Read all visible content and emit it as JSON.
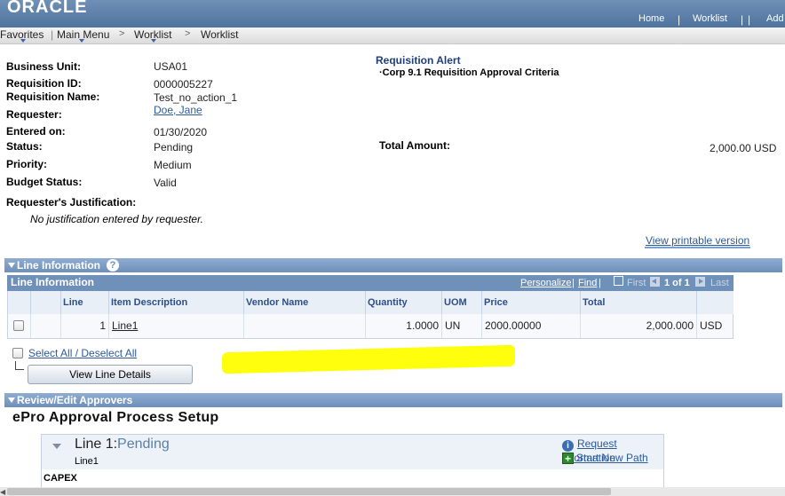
{
  "brand": {
    "logo": "ORACLE"
  },
  "header": {
    "links": [
      "Home",
      "Worklist",
      "Add"
    ]
  },
  "nav": {
    "favorites": "Favorites",
    "main_menu": "Main Menu",
    "crumb1": "Worklist",
    "crumb2": "Worklist"
  },
  "requisition": {
    "business_unit_label": "Business Unit:",
    "business_unit": "USA01",
    "req_id_label": "Requisition ID:",
    "req_id": "0000005227",
    "req_name_label": "Requisition Name:",
    "req_name": "Test_no_action_1",
    "requester_label": "Requester:",
    "requester": "Doe, Jane",
    "entered_label": "Entered on:",
    "entered": "01/30/2020",
    "status_label": "Status:",
    "status": "Pending",
    "priority_label": "Priority:",
    "priority": "Medium",
    "budget_label": "Budget Status:",
    "budget": "Valid",
    "justification_label": "Requester's Justification:",
    "justification": "No justification entered by requester."
  },
  "alert": {
    "title": "Requisition Alert",
    "item": "·Corp 9.1 Requisition Approval Criteria"
  },
  "total": {
    "label": "Total Amount:",
    "value": "2,000.00 USD"
  },
  "print_link": "View printable version",
  "line_info": {
    "section_title": "Line Information",
    "grid_title": "Line Information",
    "personalize": "Personalize",
    "find": "Find",
    "first": "First",
    "page": "1 of 1",
    "last": "Last",
    "columns": [
      "Line",
      "Item Description",
      "Vendor Name",
      "Quantity",
      "UOM",
      "Price",
      "Total"
    ],
    "rows": [
      {
        "line": "1",
        "item": "Line1",
        "vendor": "",
        "quantity": "1.0000",
        "uom": "UN",
        "price": "2000.00000",
        "total": "2,000.000",
        "currency": "USD"
      }
    ],
    "select_all": "Select All / Deselect All",
    "view_details": "View Line Details"
  },
  "approvers": {
    "section_title": "Review/Edit Approvers",
    "process_title": "ePro Approval Process Setup",
    "line_label": "Line 1:",
    "line_status": "Pending",
    "line_sub": "Line1",
    "request_info": "Request Information",
    "start_path": "Start New Path",
    "capex": "CAPEX"
  },
  "colors": {
    "banner": "#5b7fab",
    "section": "#7a98c2",
    "link": "#2d5a9a",
    "highlight": "#ffff00"
  }
}
